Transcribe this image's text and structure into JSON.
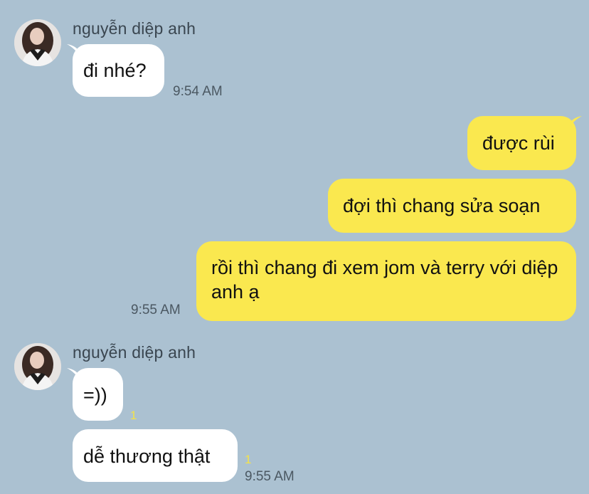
{
  "chat": {
    "groups": [
      {
        "sender": "nguyễn diệp anh",
        "messages": [
          {
            "text": "đi nhé?",
            "time": "9:54 AM"
          }
        ]
      },
      {
        "outgoing": [
          {
            "text": "được rùi"
          },
          {
            "text": "đợi thì chang sửa soạn"
          },
          {
            "text": "rồi thì chang đi xem jom và terry với diệp anh ạ",
            "time": "9:55 AM"
          }
        ]
      },
      {
        "sender": "nguyễn diệp anh",
        "messages": [
          {
            "text": "=))",
            "unread": "1"
          },
          {
            "text": "dễ thương thật",
            "unread": "1",
            "time": "9:55 AM"
          }
        ]
      }
    ]
  },
  "colors": {
    "background": "#abc1d1",
    "incoming_bubble": "#ffffff",
    "outgoing_bubble": "#fae84f",
    "unread_count": "#f3e24a"
  }
}
